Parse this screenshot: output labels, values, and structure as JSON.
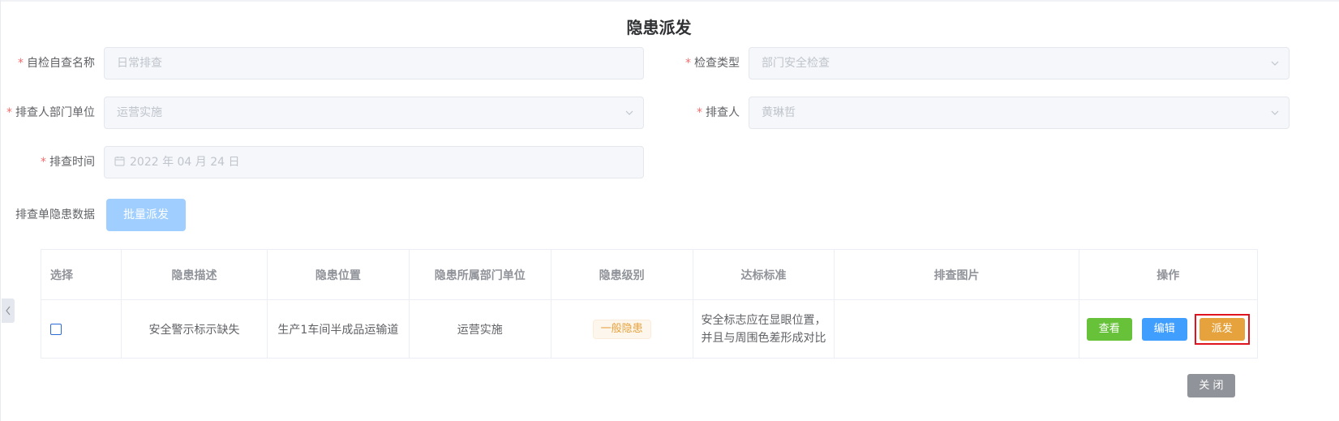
{
  "title": "隐患派发",
  "form": {
    "required_mark": "*",
    "self_check_name": {
      "label": "自检自查名称",
      "value": "日常排查"
    },
    "check_type": {
      "label": "检查类型",
      "value": "部门安全检查"
    },
    "dept_unit": {
      "label": "排查人部门单位",
      "value": "运营实施"
    },
    "checker": {
      "label": "排查人",
      "value": "黄琳哲"
    },
    "check_time": {
      "label": "排查时间",
      "value": "2022 年 04 月 24 日"
    },
    "hazard_data_label": "排查单隐患数据",
    "batch_dispatch": "批量派发"
  },
  "table": {
    "headers": [
      "选择",
      "隐患描述",
      "隐患位置",
      "隐患所属部门单位",
      "隐患级别",
      "达标标准",
      "排查图片",
      "操作"
    ],
    "rows": [
      {
        "description": "安全警示标示缺失",
        "location": "生产1车间半成品运输道",
        "department": "运营实施",
        "level": "一般隐患",
        "standard_line1": "安全标志应在显眼位置，",
        "standard_line2": "并且与周围色差形成对比",
        "image": "",
        "actions": {
          "view": "查看",
          "edit": "编辑",
          "dispatch": "派发"
        }
      }
    ]
  },
  "close_button": "关 闭",
  "colors": {
    "primary_light": "#a0cfff",
    "view": "#67c23a",
    "edit": "#409eff",
    "dispatch": "#e6a23c",
    "highlight_box": "#e0141e",
    "close": "#909399"
  },
  "icons": [
    "calendar-icon",
    "chevron-down-icon",
    "chevron-left-icon"
  ]
}
